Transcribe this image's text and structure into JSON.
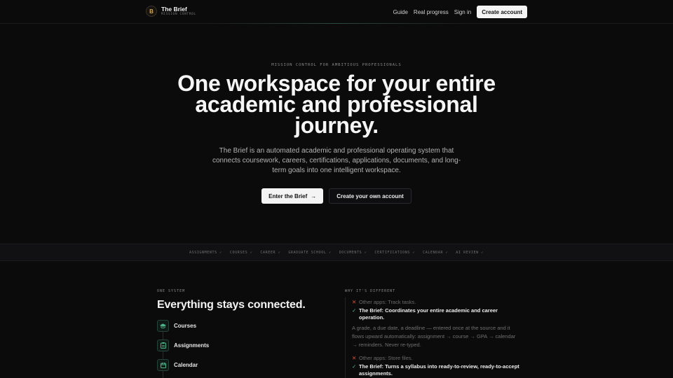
{
  "nav": {
    "brand_mark": "B",
    "brand_name": "The Brief",
    "brand_sub": "MISSION CONTROL",
    "links": [
      "Guide",
      "Real progress",
      "Sign in"
    ],
    "cta": "Create account"
  },
  "hero": {
    "eyebrow": "MISSION CONTROL FOR AMBITIOUS PROFESSIONALS",
    "headline": "One workspace for your entire academic and professional journey.",
    "subhead": "The Brief is an automated academic and professional operating system that connects coursework, careers, certifications, applications, documents, and long-term goals into one intelligent workspace.",
    "primary_button": "Enter the Brief",
    "secondary_button": "Create your own account"
  },
  "strip": {
    "items": [
      "ASSIGNMENTS ✓",
      "COURSES ✓",
      "CAREER ✓",
      "GRADUATE SCHOOL ✓",
      "DOCUMENTS ✓",
      "CERTIFICATIONS ✓",
      "CALENDAR ✓",
      "AI REVIEW ✓"
    ]
  },
  "system": {
    "label": "ONE SYSTEM",
    "title": "Everything stays connected.",
    "items": [
      {
        "label": "Courses",
        "icon": "graduation-cap-icon"
      },
      {
        "label": "Assignments",
        "icon": "clipboard-icon"
      },
      {
        "label": "Calendar",
        "icon": "calendar-icon"
      }
    ]
  },
  "different": {
    "label": "WHY IT'S DIFFERENT",
    "comparisons": [
      {
        "other": "Other apps: Track tasks.",
        "brief": "The Brief: Coordinates your entire academic and career operation.",
        "desc": "A grade, a due date, a deadline — entered once at the source and it flows upward automatically: assignment → course → GPA → calendar → reminders. Never re-typed."
      },
      {
        "other": "Other apps: Store files.",
        "brief": "The Brief: Turns a syllabus into ready-to-review, ready-to-accept assignments."
      }
    ]
  },
  "colors": {
    "background": "#0b0b0c",
    "accent_green": "#4fb58a",
    "accent_red": "#d2553d",
    "brand_gold": "#d8a94a"
  }
}
